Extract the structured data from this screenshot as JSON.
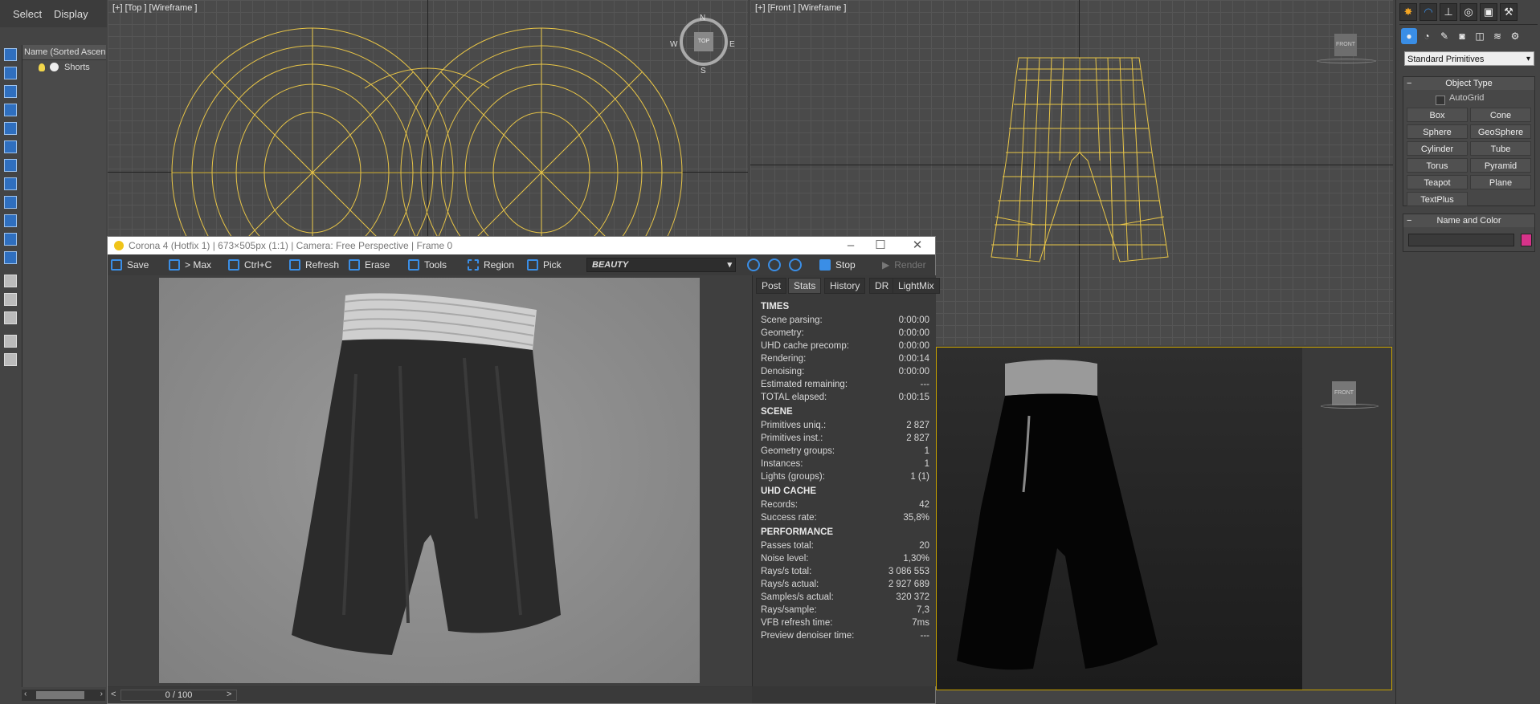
{
  "explorer": {
    "menu": {
      "select": "Select",
      "display": "Display"
    },
    "column_header": "Name (Sorted Ascending)",
    "items": [
      {
        "label": "Shorts"
      }
    ]
  },
  "viewports": {
    "top": {
      "label": "[+] [Top ] [Wireframe ]"
    },
    "front": {
      "label": "[+] [Front ] [Wireframe ]"
    },
    "gizmo": {
      "n": "N",
      "s": "S",
      "e": "E",
      "w": "W",
      "cube_top": "TOP",
      "cube_front": "FRONT",
      "cube_persp": "FRONT"
    }
  },
  "command_panel": {
    "category_dropdown": "Standard Primitives",
    "object_type": {
      "title": "Object Type",
      "autogrid": "AutoGrid",
      "buttons": [
        "Box",
        "Cone",
        "Sphere",
        "GeoSphere",
        "Cylinder",
        "Tube",
        "Torus",
        "Pyramid",
        "Teapot",
        "Plane",
        "TextPlus"
      ]
    },
    "name_and_color": {
      "title": "Name and Color",
      "name_value": "",
      "swatch_color": "#d6338a"
    }
  },
  "vfb": {
    "title": "Corona 4 (Hotfix 1) | 673×505px (1:1) | Camera: Free Perspective | Frame 0",
    "toolbar": {
      "save": "Save",
      "to_max": "> Max",
      "copy": "Ctrl+C",
      "refresh": "Refresh",
      "erase": "Erase",
      "tools": "Tools",
      "region": "Region",
      "pick": "Pick",
      "pass": "BEAUTY",
      "stop": "Stop",
      "render": "Render"
    },
    "tabs": [
      "Post",
      "Stats",
      "History",
      "DR",
      "LightMix"
    ],
    "stats": {
      "times_title": "TIMES",
      "times": [
        {
          "k": "Scene parsing:",
          "v": "0:00:00"
        },
        {
          "k": "Geometry:",
          "v": "0:00:00"
        },
        {
          "k": "UHD cache precomp:",
          "v": "0:00:00"
        },
        {
          "k": "Rendering:",
          "v": "0:00:14"
        },
        {
          "k": "Denoising:",
          "v": "0:00:00"
        },
        {
          "k": "Estimated remaining:",
          "v": "---"
        },
        {
          "k": "TOTAL elapsed:",
          "v": "0:00:15"
        }
      ],
      "scene_title": "SCENE",
      "scene": [
        {
          "k": "Primitives uniq.:",
          "v": "2 827"
        },
        {
          "k": "Primitives inst.:",
          "v": "2 827"
        },
        {
          "k": "Geometry groups:",
          "v": "1"
        },
        {
          "k": "Instances:",
          "v": "1"
        },
        {
          "k": "Lights (groups):",
          "v": "1 (1)"
        }
      ],
      "uhd_title": "UHD CACHE",
      "uhd": [
        {
          "k": "Records:",
          "v": "42"
        },
        {
          "k": "Success rate:",
          "v": "35,8%"
        }
      ],
      "perf_title": "PERFORMANCE",
      "perf": [
        {
          "k": "Passes total:",
          "v": "20"
        },
        {
          "k": "Noise level:",
          "v": "1,30%"
        },
        {
          "k": "Rays/s total:",
          "v": "3 086 553"
        },
        {
          "k": "Rays/s actual:",
          "v": "2 927 689"
        },
        {
          "k": "Samples/s actual:",
          "v": "320 372"
        },
        {
          "k": "Rays/sample:",
          "v": "7,3"
        },
        {
          "k": "VFB refresh time:",
          "v": "7ms"
        },
        {
          "k": "Preview denoiser time:",
          "v": "---"
        }
      ]
    },
    "history_slider": "0 / 100"
  }
}
